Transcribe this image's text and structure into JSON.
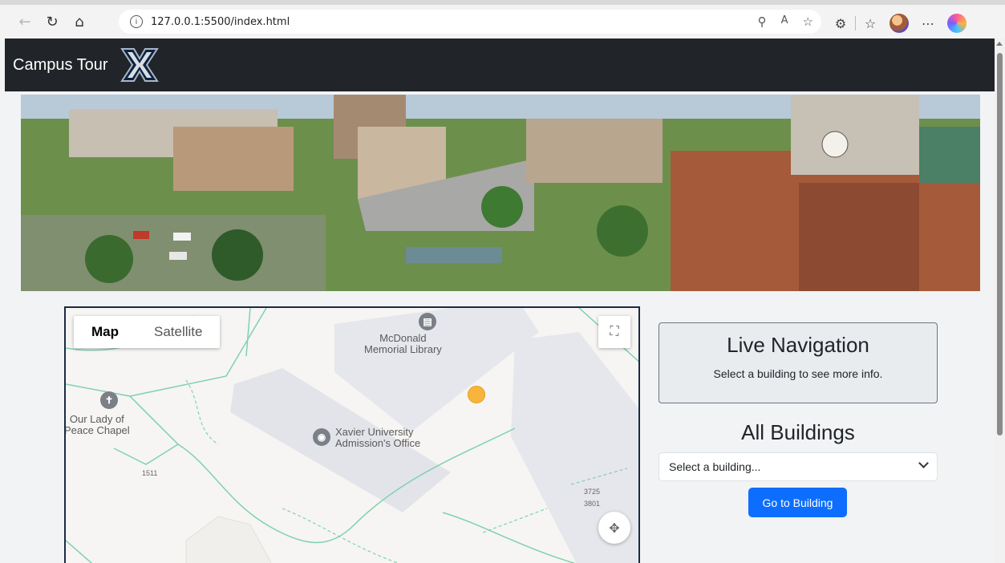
{
  "browser": {
    "url": "127.0.0.1:5500/index.html",
    "info_glyph": "i",
    "icons": [
      "back-icon",
      "reload-icon",
      "home-icon",
      "location-icon",
      "read-aloud-icon",
      "favorite-star-icon",
      "extensions-icon",
      "favorites-icon",
      "profile-avatar",
      "more-icon",
      "copilot-icon"
    ]
  },
  "navbar": {
    "title": "Campus Tour",
    "logo_letter": "X",
    "bg_color": "#212529"
  },
  "map": {
    "types": [
      "Map",
      "Satellite"
    ],
    "selected_type": "Map",
    "labels": {
      "library": "McDonald\nMemorial Library",
      "admissions": "Xavier University\nAdmission's Office",
      "chapel": "Our Lady of\nPeace Chapel"
    },
    "numbers": {
      "n1511": "1511",
      "n3725": "3725",
      "n3801": "3801"
    },
    "location_color": "#f9b43c"
  },
  "panel": {
    "live_title": "Live Navigation",
    "live_subtitle": "Select a building to see more info.",
    "all_title": "All Buildings",
    "select_value": "Select a building...",
    "go_button": "Go to Building",
    "accent_color": "#0d6efd"
  }
}
